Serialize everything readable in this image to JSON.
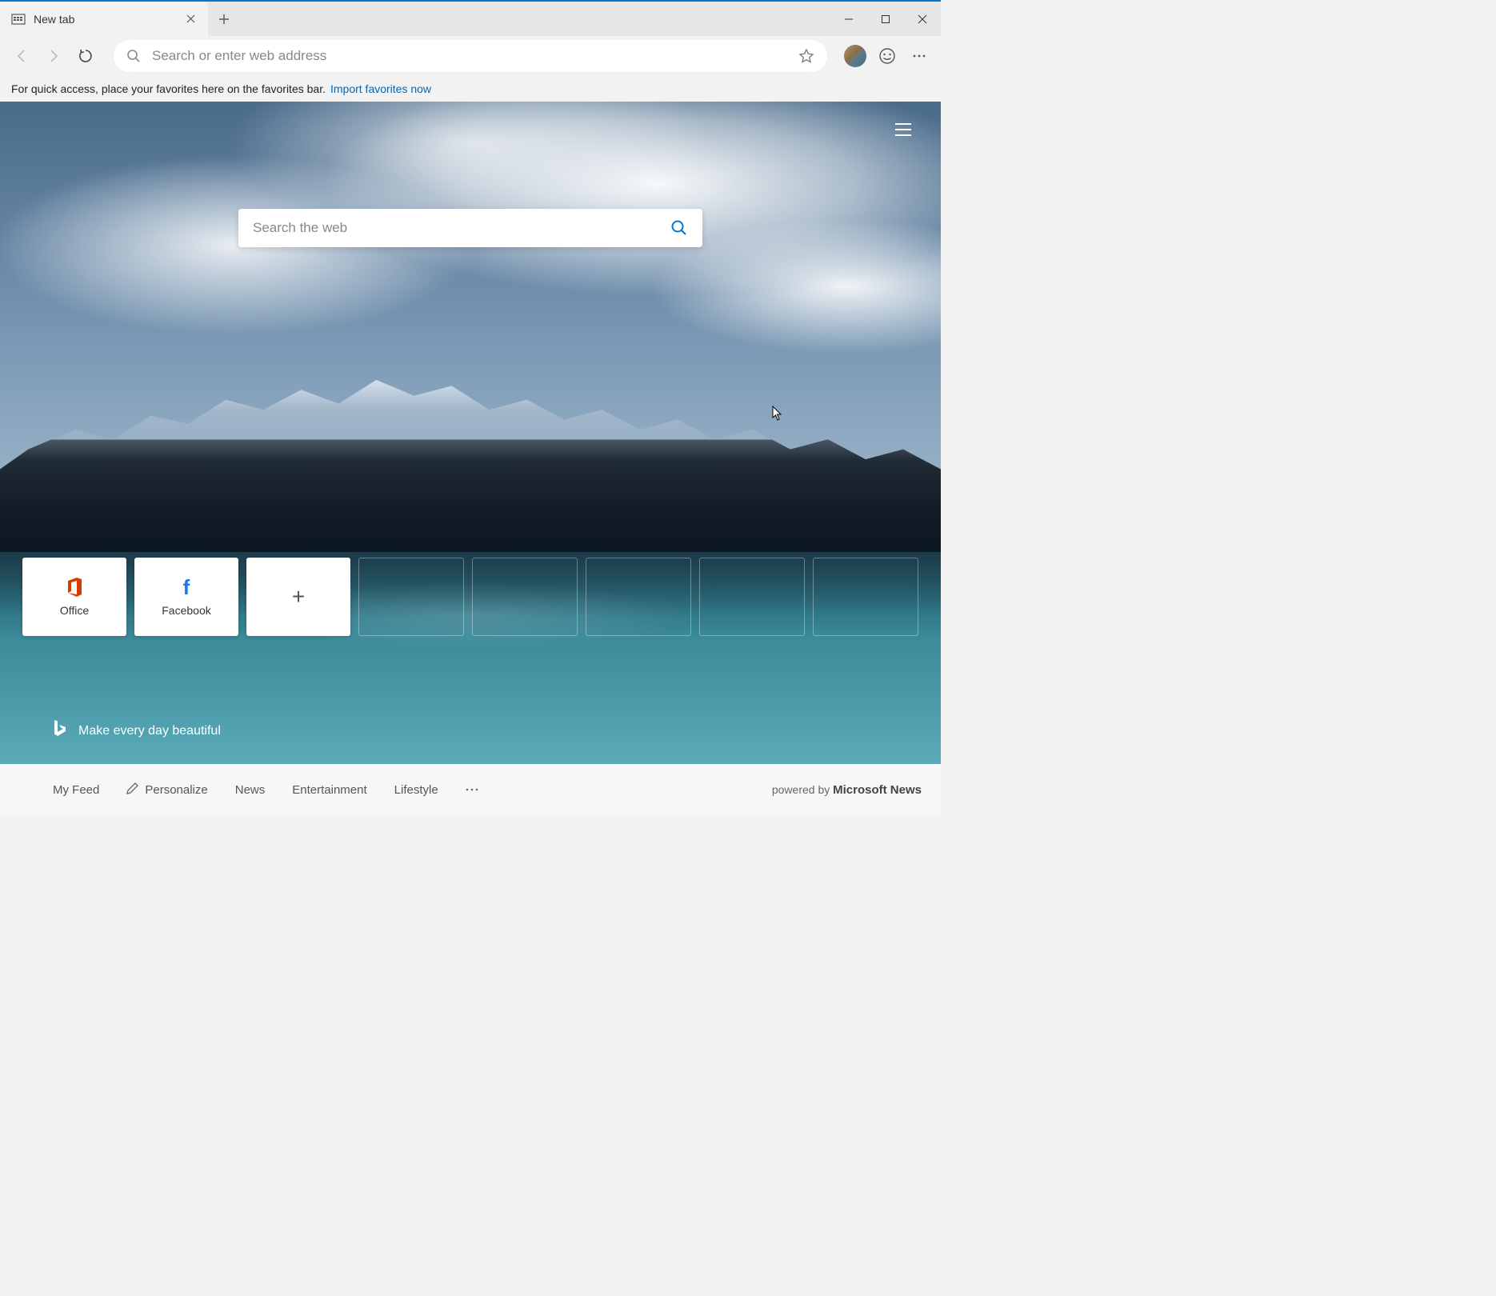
{
  "window": {
    "tab_title": "New tab"
  },
  "toolbar": {
    "address_placeholder": "Search or enter web address"
  },
  "favorites_bar": {
    "hint": "For quick access, place your favorites here on the favorites bar.",
    "import_link": "Import favorites now"
  },
  "hero": {
    "search_placeholder": "Search the web",
    "bing_tagline": "Make every day beautiful",
    "tiles": [
      {
        "label": "Office",
        "icon": "office"
      },
      {
        "label": "Facebook",
        "icon": "facebook"
      },
      {
        "label": "",
        "icon": "add"
      }
    ]
  },
  "footer": {
    "items": [
      "My Feed",
      "Personalize",
      "News",
      "Entertainment",
      "Lifestyle"
    ],
    "powered_prefix": "powered by",
    "powered_brand": "Microsoft News"
  }
}
